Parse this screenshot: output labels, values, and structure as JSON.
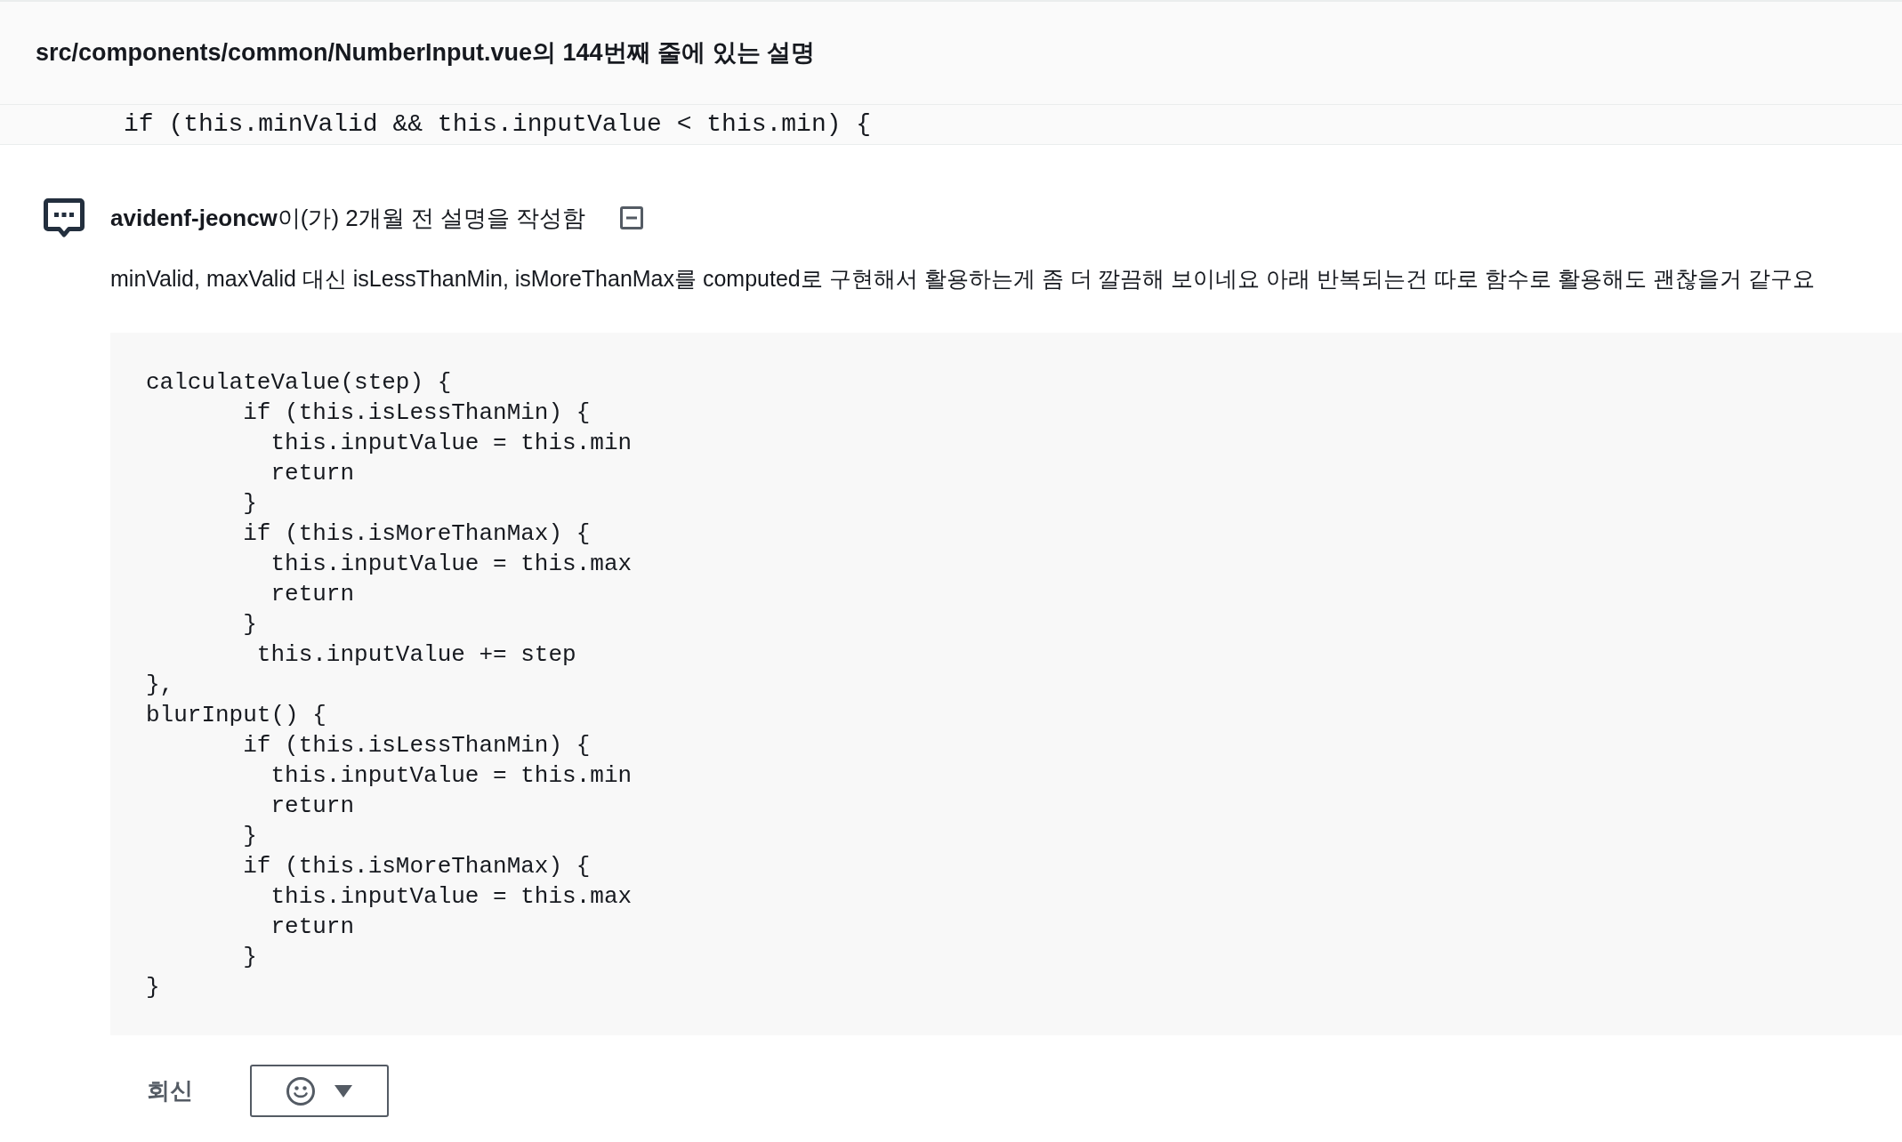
{
  "file_comment": {
    "title": "src/components/common/NumberInput.vue의 144번째 줄에 있는 설명",
    "code_line": "if (this.minValid && this.inputValue < this.min) {"
  },
  "comment": {
    "byline": "**avidenf-jeoncw**이(가) 2개월 전 설명을 작성함",
    "expanded": true,
    "text": "minValid, maxValid 대신 isLessThanMin, isMoreThanMax를 computed로 구현해서 활용하는게 좀 더 깔끔해 보이네요 아래 반복되는건 따로 함수로 활용해도 괜찮을거 같구요",
    "code": "calculateValue(step) {\n       if (this.isLessThanMin) {\n         this.inputValue = this.min\n         return\n       }\n       if (this.isMoreThanMax) {\n         this.inputValue = this.max\n         return\n       }\n        this.inputValue += step\n},\nblurInput() {\n       if (this.isLessThanMin) {\n         this.inputValue = this.min\n         return\n       }\n       if (this.isMoreThanMax) {\n         this.inputValue = this.max\n         return\n       }\n}"
  },
  "reply": {
    "label": "회신"
  }
}
